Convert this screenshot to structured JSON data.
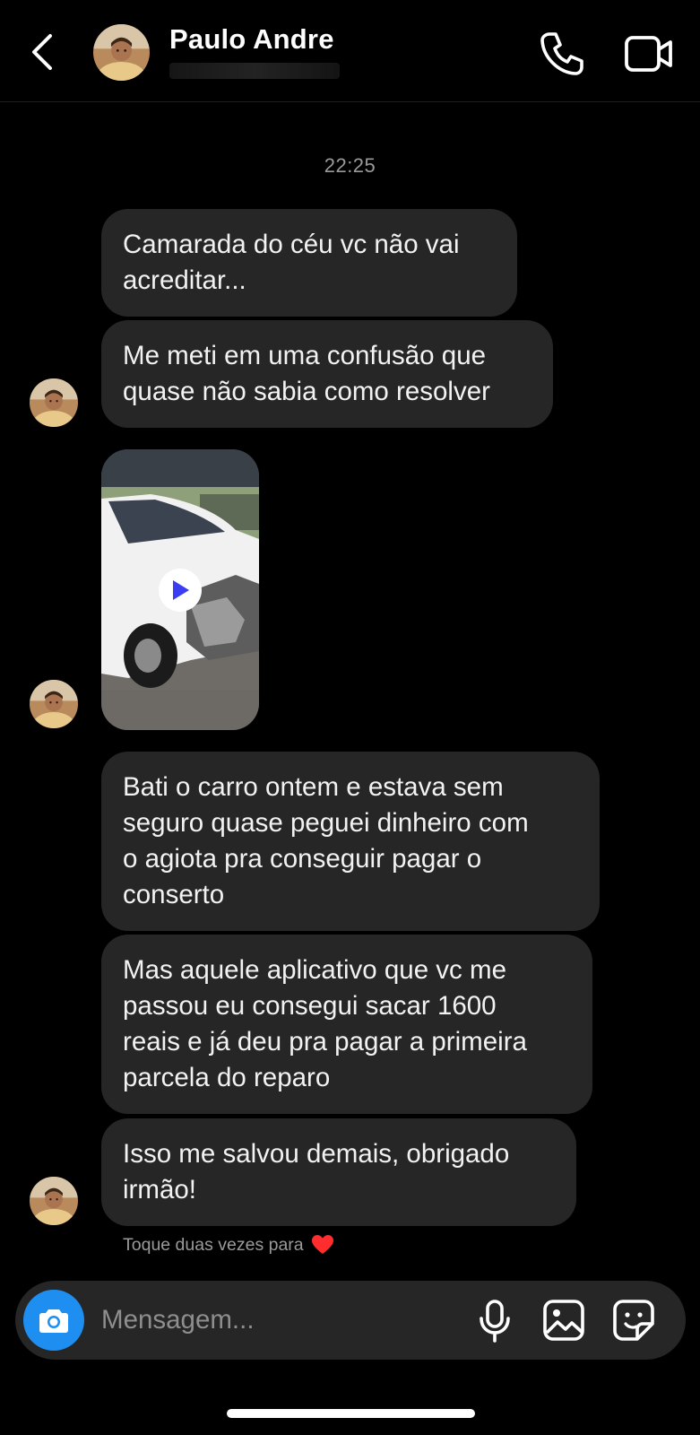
{
  "header": {
    "contact_name": "Paulo Andre",
    "back_icon": "chevron-left-icon",
    "call_icon": "phone-icon",
    "video_icon": "video-camera-icon"
  },
  "conversation": {
    "timestamp": "22:25",
    "messages": [
      {
        "lines": [
          "Camarada do céu vc não vai",
          "acreditar..."
        ]
      },
      {
        "lines": [
          "Me meti em uma confusão que",
          "quase não sabia como resolver"
        ]
      },
      {
        "type": "video",
        "icon": "play-icon"
      },
      {
        "lines": [
          "Bati o carro ontem e estava sem",
          "seguro quase peguei dinheiro com",
          "o agiota pra conseguir pagar o",
          "conserto"
        ]
      },
      {
        "lines": [
          "Mas aquele aplicativo que vc me",
          "passou eu consegui sacar 1600",
          "reais e já deu pra pagar a primeira",
          "parcela do reparo"
        ]
      },
      {
        "lines": [
          "Isso me salvou demais, obrigado",
          "irmão!"
        ]
      }
    ],
    "double_tap_hint": "Toque duas vezes para",
    "heart_icon": "red-heart-icon"
  },
  "composer": {
    "placeholder": "Mensagem...",
    "camera_icon": "camera-icon",
    "mic_icon": "microphone-icon",
    "gallery_icon": "image-icon",
    "sticker_icon": "sticker-icon"
  },
  "colors": {
    "background": "#000000",
    "bubble": "#262626",
    "accent_blue": "#1f8ef1",
    "heart_red": "#ff2d2d",
    "muted_text": "#9a9a9a"
  }
}
